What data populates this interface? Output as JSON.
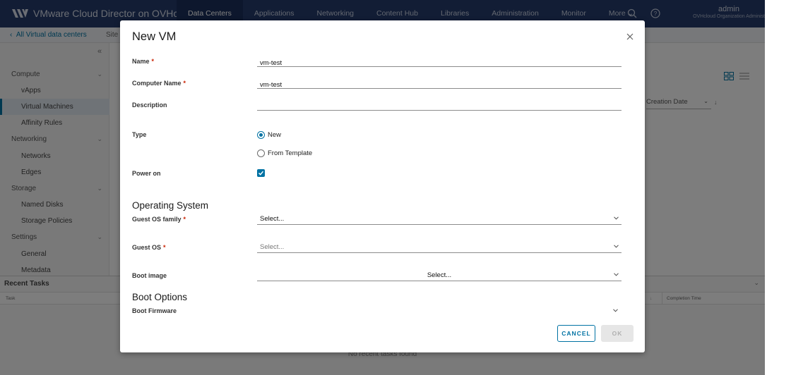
{
  "app": {
    "brand": "VMware Cloud Director on OVHcloud",
    "nav": [
      "Data Centers",
      "Applications",
      "Networking",
      "Content Hub",
      "Libraries",
      "Administration",
      "Monitor",
      "More"
    ],
    "active_nav": "Data Centers",
    "user": {
      "name": "admin",
      "org": "OVHcloud Organization Administ"
    }
  },
  "subbar": {
    "back_link": "All Virtual data centers",
    "site": "Site"
  },
  "sidebar": {
    "collapse_glyph": "«",
    "compute": "Compute",
    "vapps": "vApps",
    "virtual_machines": "Virtual Machines",
    "affinity_rules": "Affinity Rules",
    "networking": "Networking",
    "networks": "Networks",
    "edges": "Edges",
    "storage": "Storage",
    "named_disks": "Named Disks",
    "storage_policies": "Storage Policies",
    "settings": "Settings",
    "general": "General",
    "metadata": "Metadata"
  },
  "main": {
    "sort_value": "Creation Date",
    "sort_direction": "↓"
  },
  "tasks": {
    "title": "Recent Tasks",
    "col_task": "Task",
    "col_completion": "Completion Time",
    "empty": "No recent tasks found"
  },
  "modal": {
    "title": "New VM",
    "required_mark": "*",
    "name_label": "Name",
    "name_value": "vm-test",
    "computer_name_label": "Computer Name",
    "computer_name_value": "vm-test",
    "description_label": "Description",
    "description_value": "",
    "type_label": "Type",
    "type_new": "New",
    "type_template": "From Template",
    "type_selected": "New",
    "power_on_label": "Power on",
    "power_on": true,
    "os_section": "Operating System",
    "guest_os_family_label": "Guest OS family",
    "guest_os_family_value": "Select...",
    "guest_os_label": "Guest OS",
    "guest_os_value": "Select...",
    "boot_image_label": "Boot image",
    "boot_image_value": "Select...",
    "boot_section": "Boot Options",
    "boot_firmware_label": "Boot Firmware",
    "cancel": "CANCEL",
    "ok": "OK"
  },
  "colors": {
    "nav_bg": "#243a6b",
    "accent": "#0072a3",
    "required": "#c92100"
  },
  "icons": [
    "vmware-logo-icon",
    "search-icon",
    "help-icon",
    "grid-view-icon",
    "list-view-icon",
    "close-icon",
    "chevron-down-icon",
    "checkmark-icon"
  ]
}
